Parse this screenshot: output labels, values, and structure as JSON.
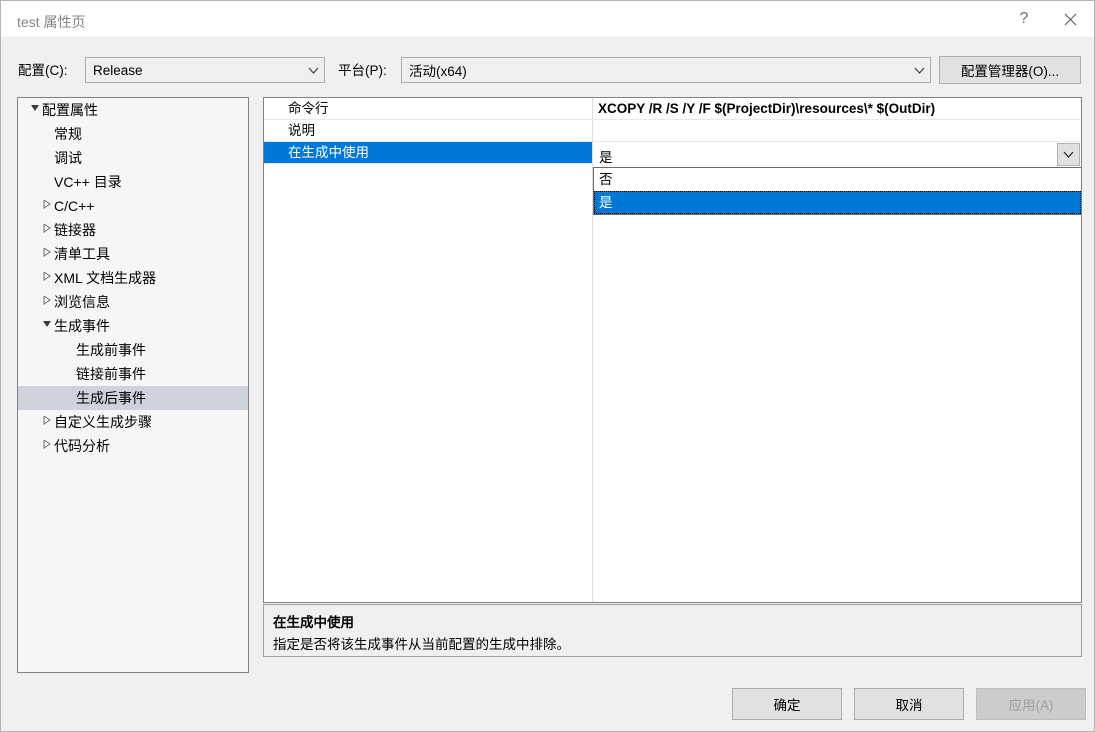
{
  "window": {
    "title": "test 属性页",
    "help_icon": "question-mark-icon",
    "close_icon": "close-icon"
  },
  "config_bar": {
    "config_label": "配置(C):",
    "config_value": "Release",
    "platform_label": "平台(P):",
    "platform_value": "活动(x64)",
    "config_manager_label": "配置管理器(O)..."
  },
  "tree": {
    "items": [
      {
        "label": "配置属性",
        "indent": 0,
        "twisty": "expanded",
        "selected": false
      },
      {
        "label": "常规",
        "indent": 1,
        "twisty": "none",
        "selected": false
      },
      {
        "label": "调试",
        "indent": 1,
        "twisty": "none",
        "selected": false
      },
      {
        "label": "VC++ 目录",
        "indent": 1,
        "twisty": "none",
        "selected": false
      },
      {
        "label": "C/C++",
        "indent": 1,
        "twisty": "collapsed",
        "selected": false
      },
      {
        "label": "链接器",
        "indent": 1,
        "twisty": "collapsed",
        "selected": false
      },
      {
        "label": "清单工具",
        "indent": 1,
        "twisty": "collapsed",
        "selected": false
      },
      {
        "label": "XML 文档生成器",
        "indent": 1,
        "twisty": "collapsed",
        "selected": false
      },
      {
        "label": "浏览信息",
        "indent": 1,
        "twisty": "collapsed",
        "selected": false
      },
      {
        "label": "生成事件",
        "indent": 1,
        "twisty": "expanded",
        "selected": false
      },
      {
        "label": "生成前事件",
        "indent": 2,
        "twisty": "none",
        "selected": false
      },
      {
        "label": "链接前事件",
        "indent": 2,
        "twisty": "none",
        "selected": false
      },
      {
        "label": "生成后事件",
        "indent": 2,
        "twisty": "none",
        "selected": true
      },
      {
        "label": "自定义生成步骤",
        "indent": 1,
        "twisty": "collapsed",
        "selected": false
      },
      {
        "label": "代码分析",
        "indent": 1,
        "twisty": "collapsed",
        "selected": false
      }
    ]
  },
  "property_grid": {
    "rows": [
      {
        "name": "命令行",
        "value": "XCOPY /R /S /Y /F $(ProjectDir)\\resources\\* $(OutDir)",
        "selected": false
      },
      {
        "name": "说明",
        "value": "",
        "selected": false
      },
      {
        "name": "在生成中使用",
        "value": "",
        "selected": true
      }
    ],
    "editor": {
      "value": "是",
      "dropdown_icon": "chevron-down-icon",
      "options": [
        {
          "label": "否",
          "selected": false
        },
        {
          "label": "是",
          "selected": true
        }
      ]
    }
  },
  "description": {
    "title": "在生成中使用",
    "body": "指定是否将该生成事件从当前配置的生成中排除。"
  },
  "footer": {
    "ok_label": "确定",
    "cancel_label": "取消",
    "apply_label": "应用(A)"
  },
  "colors": {
    "accent": "#0078d7",
    "tree_selection": "#cdd2dd",
    "dialog_bg": "#f0f0f0"
  }
}
